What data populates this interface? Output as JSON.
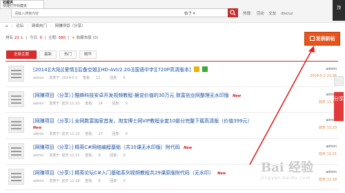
{
  "browser": {
    "favorites_popup": {
      "title": "收藏夹",
      "subtitle": "快捷打开收藏夹"
    },
    "search": {
      "placeholder": "请输入搜索内容",
      "scope": "帖子",
      "button": "search-icon"
    },
    "hot": {
      "label": "热搜:",
      "items": [
        "活动",
        "交友",
        "discuz"
      ]
    },
    "corner_label": "顶"
  },
  "breadcrumb": [
    "论坛",
    "网络热门",
    "网赚项目（分享）"
  ],
  "stats": {
    "rank_label": "排名",
    "rank_value": "22",
    "today_label": "今日:",
    "today_value": "0",
    "topics_label": "主题:",
    "topics_value": "580",
    "fav_label": "收藏本版",
    "fav_count": "(0)"
  },
  "post_button": "发表新帖",
  "tabs": [
    "全部主题",
    "最新",
    "热门",
    "精华"
  ],
  "threads": [
    {
      "category": "",
      "title": "[2014][大陆][爱情][后备空姐][HD-AVI/2.2G][国语中字][720P高清版本]",
      "new": "",
      "author": "admin",
      "post_time": "发表于: 2014-5-2",
      "views": "12",
      "replies": "0",
      "last_user": "admin",
      "last_time": "2014-5-2 21:26"
    },
    {
      "category": "[网赚项目（分享）]",
      "title": "酷蜂科技安卓开发视频教程-据说价值的30万元 致富创业网整理无水印版",
      "new": "New",
      "author": "admin",
      "post_time": "发表于: 前天 11:23",
      "views": "14",
      "replies": "0",
      "last_user": "admin",
      "last_time": "前天 11:23"
    },
    {
      "category": "[网赚项目（分享）]",
      "title": "全网数富独家首发，淘宝博士网VIP教程全套10部分完整下载高清版（价值399元）",
      "new": "New",
      "author": "admin",
      "post_time": "发表于: 前天 11:23",
      "views": "17",
      "replies": "0",
      "last_user": "admin",
      "last_time": "前天 11:23"
    },
    {
      "category": "[网赚项目（分享）]",
      "title": "精英C#网络编程基础（共10课无水印版）附代码",
      "new": "New",
      "author": "admin",
      "post_time": "发表于: 前天 11:21",
      "views": "9",
      "replies": "0",
      "last_user": "admin",
      "last_time": "前天 11:21"
    },
    {
      "category": "[网赚项目（分享）]",
      "title": "精英论坛C#入门基础系列视频教程共29课原版附代码（无水印）",
      "new": "New",
      "author": "admin",
      "post_time": "发表于: 前天 11:19",
      "views": "8",
      "replies": "0",
      "last_user": "admin",
      "last_time": "前天 11:19"
    }
  ],
  "labels": {
    "views": "查看:",
    "replies": "回复:"
  },
  "share": "分享",
  "watermark": {
    "main": "Bai 经验",
    "sub": "jingyan.baidu.com"
  },
  "colors": {
    "accent": "#d92b2b",
    "link": "#1a4fa3",
    "post_button": "#e8541d",
    "new_tag": "#d31414"
  }
}
